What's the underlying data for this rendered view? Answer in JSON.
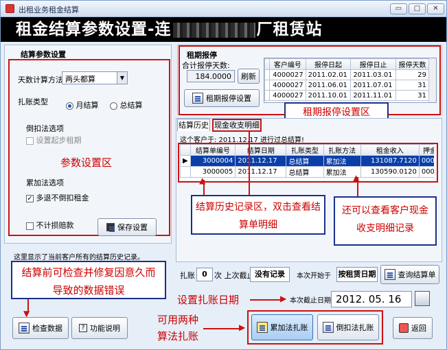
{
  "window": {
    "title": "出租业务租金结算",
    "banner_title": "租金结算参数设置-连",
    "banner_suffix": "厂租赁站",
    "minimize": "▭",
    "maximize": "□",
    "close": "✕"
  },
  "params": {
    "section_title": "结算参数设置",
    "day_method_label": "天数计算方法",
    "day_method_value": "两头都算",
    "billing_type_label": "扎账类型",
    "monthly_label": "月结算",
    "total_label": "总结算",
    "inverse_group_label": "倒扣法选项",
    "inverse_start_label": "设置起步租期",
    "area_callout": "参数设置区",
    "cumulative_group_label": "累加法选项",
    "cumulative_option_label": "多退不倒扣租金",
    "no_damage_label": "不计损赔款",
    "save_button": "保存设置"
  },
  "suspend": {
    "section_title": "租期报停",
    "total_days_label": "合计报停天数:",
    "total_days_value": "184.0000",
    "refresh_button": "刷新",
    "setup_button": "租期报停设置",
    "headers": [
      "客户编号",
      "报停日起",
      "报停日止",
      "报停天数"
    ],
    "rows": [
      [
        "4000027",
        "2011.02.01",
        "2011.03.01",
        "29"
      ],
      [
        "4000027",
        "2011.06.01",
        "2011.07.01",
        "31"
      ],
      [
        "4000027",
        "2011.10.01",
        "2011.11.01",
        "31"
      ]
    ],
    "callout": "租期报停设置区"
  },
  "history": {
    "tab_history": "结算历史",
    "tab_cash": "现金收支明细",
    "notice": "这个客户于: 2011.12.17 进行过总结算!",
    "headers": [
      "结算单编号",
      "结算日期",
      "扎账类型",
      "扎账方法",
      "租金收入",
      "押金"
    ],
    "rows": [
      [
        "3000004",
        "2011.12.17",
        "总结算",
        "累加法",
        "131087.7120",
        "000"
      ],
      [
        "3000005",
        "2011.12.17",
        "总结算",
        "累加法",
        "130590.0120",
        "000"
      ]
    ],
    "callout_history": "结算历史记录区，双击查看结算单明细",
    "callout_cash": "还可以查看客户现金收支明细记录",
    "status_text": "这里显示了当前客户所有的结算历史记录。"
  },
  "summary": {
    "billing_label": "扎账",
    "billing_count": "0",
    "last_cut_label": "次 上次截止",
    "last_cut_value": "没有记录",
    "next_start_label": "本次开始于",
    "next_start_value": "按租赁日期",
    "query_button": "查询结算单",
    "cutoff_label": "本次截止日期",
    "cutoff_value": "2012. 05. 16",
    "cutoff_callout": "设置扎账日期"
  },
  "actions": {
    "check_callout": "结算前可检查并修复因意久而导致的数据错误",
    "check_button": "检查数据",
    "help_button": "功能说明",
    "methods_callout": "可用两种算法扎账",
    "cumulative_button": "累加法扎账",
    "inverse_button": "倒扣法扎账",
    "return_button": "返回"
  }
}
